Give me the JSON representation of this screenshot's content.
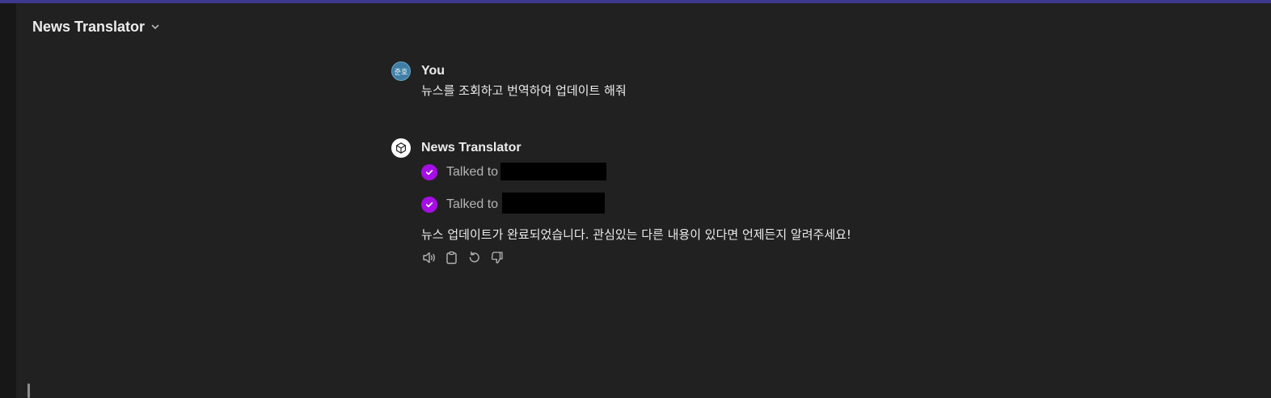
{
  "header": {
    "title": "News Translator",
    "chevron_icon": "chevron-down-icon"
  },
  "conversation": {
    "user_message": {
      "author": "You",
      "avatar_text": "준호",
      "avatar_color": "#3f7fa6",
      "text": "뉴스를 조회하고 번역하여 업데이트 해줘"
    },
    "assistant_message": {
      "author": "News Translator",
      "avatar_icon": "cube-icon",
      "tool_calls": [
        {
          "status_icon": "check-circle-icon",
          "label": "Talked to"
        },
        {
          "status_icon": "check-circle-icon",
          "label": "Talked to"
        }
      ],
      "text": "뉴스 업데이트가 완료되었습니다. 관심있는 다른 내용이 있다면 언제든지 알려주세요!",
      "actions": [
        {
          "name": "read-aloud-button",
          "icon": "speaker-icon"
        },
        {
          "name": "copy-button",
          "icon": "clipboard-icon"
        },
        {
          "name": "regenerate-button",
          "icon": "refresh-icon"
        },
        {
          "name": "bad-response-button",
          "icon": "thumbs-down-icon"
        }
      ]
    }
  },
  "colors": {
    "background": "#212121",
    "sidebar": "#171717",
    "top_accent": "#3b3a8c",
    "tool_check": "#a60ee5",
    "text": "#ececec",
    "muted_text": "#b4b4b4"
  }
}
